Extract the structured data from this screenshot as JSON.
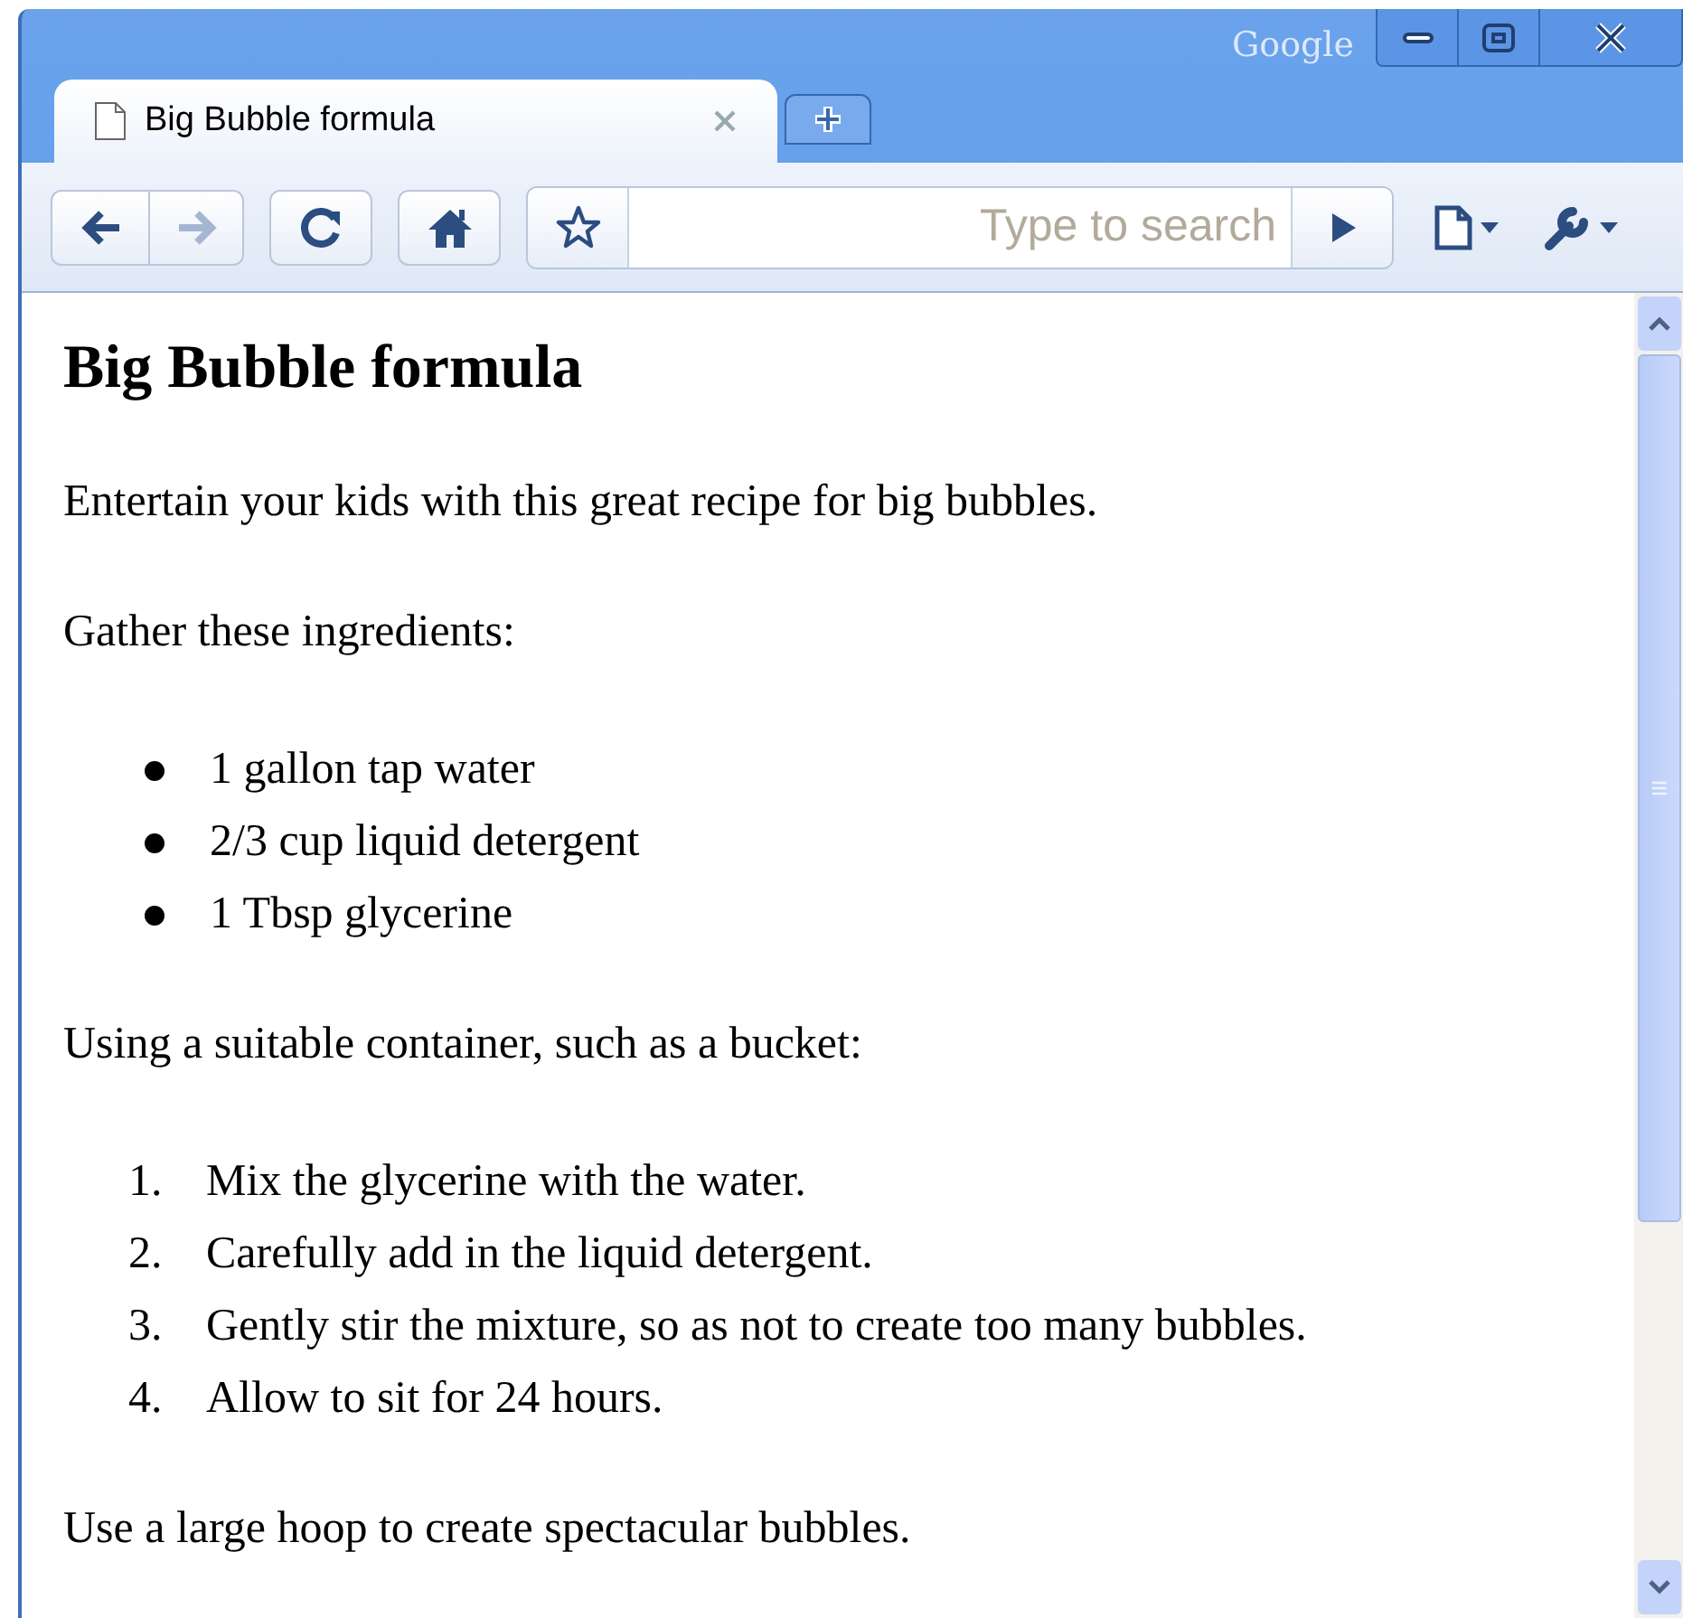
{
  "window": {
    "brand": "Google"
  },
  "tabs": [
    {
      "label": "Big Bubble formula",
      "selected": true
    }
  ],
  "toolbar": {
    "address_placeholder": "Type to search"
  },
  "page": {
    "heading": "Big Bubble formula",
    "blocks": [
      {
        "kind": "paragraph",
        "text": "Entertain your kids with this great recipe for big bubbles."
      },
      {
        "kind": "paragraph",
        "text": "Gather these ingredients:"
      },
      {
        "kind": "bullets",
        "items": [
          "1 gallon tap water",
          "2/3 cup liquid detergent",
          "1 Tbsp glycerine"
        ]
      },
      {
        "kind": "paragraph",
        "text": "Using a suitable container, such as a bucket:"
      },
      {
        "kind": "numbered",
        "items": [
          {
            "number": "1.",
            "text": "Mix the glycerine with the water."
          },
          {
            "number": "2.",
            "text": "Carefully add in the liquid detergent."
          },
          {
            "number": "3.",
            "text": "Gently stir the mixture, so as not to create too many bubbles."
          },
          {
            "number": "4.",
            "text": "Allow to sit for 24 hours."
          }
        ]
      },
      {
        "kind": "paragraph",
        "text": "Use a large hoop to create spectacular bubbles."
      }
    ]
  }
}
